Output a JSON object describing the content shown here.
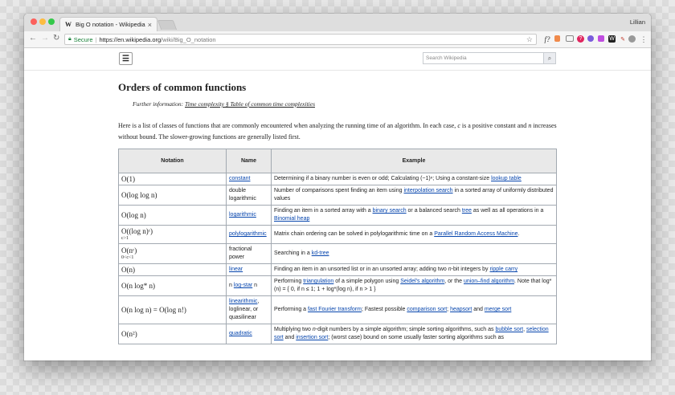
{
  "browser": {
    "tab_title": "Big O notation - Wikipedia",
    "tab_close": "×",
    "tab_logo": "W",
    "user": "Lillian",
    "secure_label": "Secure",
    "url_host": "https://en.wikipedia.org",
    "url_path": "/wiki/Big_O_notation",
    "nav": {
      "back": "←",
      "forward": "→",
      "reload": "C"
    },
    "star": "☆",
    "ext_f": "f?",
    "ext_help": "?",
    "ext_w": "W",
    "ext_menu": "⋮"
  },
  "wiki": {
    "menu_icon": "☰",
    "search_placeholder": "Search Wikipedia",
    "search_icon": "🔍"
  },
  "article": {
    "heading": "Orders of common functions",
    "further_label": "Further information:",
    "further_link": "Time complexity § Table of common time complexities",
    "intro_1": "Here is a list of classes of functions that are commonly encountered when analyzing the running time of an algorithm. In each case,",
    "intro_c": "c",
    "intro_2": "is a positive constant and",
    "intro_n": "n",
    "intro_3": "increases without bound. The slower-growing functions are generally listed first."
  },
  "table": {
    "headers": [
      "Notation",
      "Name",
      "Example"
    ],
    "rows": [
      {
        "notation": "O(1)",
        "sub": "",
        "name": "constant",
        "name_link": true,
        "example": [
          {
            "t": "Determining if a binary number is even or odd; Calculating "
          },
          {
            "t": "(−1)ⁿ"
          },
          {
            "t": "; Using a constant-size "
          },
          {
            "t": "lookup table",
            "link": true
          }
        ]
      },
      {
        "notation": "O(log log n)",
        "sub": "",
        "name": "double logarithmic",
        "name_link": false,
        "example": [
          {
            "t": "Number of comparisons spent finding an item using "
          },
          {
            "t": "interpolation search",
            "link": true
          },
          {
            "t": " in a sorted array of uniformly distributed values"
          }
        ]
      },
      {
        "notation": "O(log n)",
        "sub": "",
        "name": "logarithmic",
        "name_link": true,
        "example": [
          {
            "t": "Finding an item in a sorted array with a "
          },
          {
            "t": "binary search",
            "link": true
          },
          {
            "t": " or a balanced search "
          },
          {
            "t": "tree",
            "link": true
          },
          {
            "t": " as well as all operations in a "
          },
          {
            "t": "Binomial heap",
            "link": true
          }
        ]
      },
      {
        "notation": "O((log n)ᶜ)",
        "sub": "c>1",
        "name": "polylogarithmic",
        "name_link": true,
        "example": [
          {
            "t": "Matrix chain ordering can be solved in polylogarithmic time on a "
          },
          {
            "t": "Parallel Random Access Machine",
            "link": true
          },
          {
            "t": "."
          }
        ]
      },
      {
        "notation": "O(nᶜ)",
        "sub": "0<c<1",
        "name": "fractional power",
        "name_link": false,
        "example": [
          {
            "t": "Searching in a "
          },
          {
            "t": "kd-tree",
            "link": true
          }
        ]
      },
      {
        "notation": "O(n)",
        "sub": "",
        "name": "linear",
        "name_link": true,
        "example": [
          {
            "t": "Finding an item in an unsorted list or in an unsorted array; adding two "
          },
          {
            "t": "n",
            "i": true
          },
          {
            "t": "-bit integers by "
          },
          {
            "t": "ripple carry",
            "link": true
          }
        ]
      },
      {
        "notation": "O(n log* n)",
        "sub": "",
        "name_parts": [
          {
            "t": "n "
          },
          {
            "t": "log-star",
            "link": true
          },
          {
            "t": " n"
          }
        ],
        "example": [
          {
            "t": "Performing "
          },
          {
            "t": "triangulation",
            "link": true
          },
          {
            "t": " of a simple polygon using "
          },
          {
            "t": "Seidel's algorithm",
            "link": true
          },
          {
            "t": ", or the "
          },
          {
            "t": "union–find algorithm",
            "link": true
          },
          {
            "t": ". Note that log*(n) = { 0, if n ≤ 1; 1 + log*(log n), if n > 1 }"
          }
        ]
      },
      {
        "notation": "O(n log n) = O(log n!)",
        "sub": "",
        "name_parts": [
          {
            "t": "linearithmic",
            "link": true
          },
          {
            "t": ", loglinear, or quasilinear"
          }
        ],
        "example": [
          {
            "t": "Performing a "
          },
          {
            "t": "fast Fourier transform",
            "link": true
          },
          {
            "t": "; Fastest possible "
          },
          {
            "t": "comparison sort",
            "link": true
          },
          {
            "t": "; "
          },
          {
            "t": "heapsort",
            "link": true
          },
          {
            "t": " and "
          },
          {
            "t": "merge sort",
            "link": true
          }
        ]
      },
      {
        "notation": "O(n²)",
        "sub": "",
        "name": "quadratic",
        "name_link": true,
        "example": [
          {
            "t": "Multiplying two "
          },
          {
            "t": "n",
            "i": true
          },
          {
            "t": "-digit numbers by a simple algorithm; simple sorting algorithms, such as "
          },
          {
            "t": "bubble sort",
            "link": true
          },
          {
            "t": ", "
          },
          {
            "t": "selection sort",
            "link": true
          },
          {
            "t": " and "
          },
          {
            "t": "insertion sort",
            "link": true
          },
          {
            "t": "; (worst case) bound on some usually faster sorting algorithms such as"
          }
        ]
      }
    ]
  }
}
